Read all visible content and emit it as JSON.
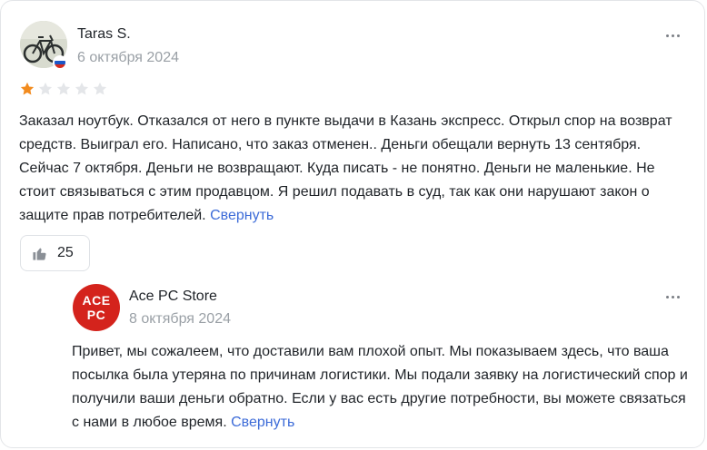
{
  "review": {
    "author": "Taras S.",
    "date": "6 октября 2024",
    "rating": 1,
    "rating_max": 5,
    "text": "Заказал ноутбук. Отказался от него в пункте выдачи в Казань экспресс. Открыл спор на возврат средств. Выиграл его. Написано, что заказ отменен.. Деньги обещали вернуть 13 сентября. Сейчас 7 октября. Деньги не возвращают. Куда писать - не понятно. Деньги не маленькие. Не стоит связываться с этим продавцом. Я решил подавать в суд, так как они нарушают закон о защите прав потребителей.",
    "collapse_label": "Свернуть",
    "likes": "25",
    "avatar_icon": "bicycle-photo",
    "flag_icon": "russia-flag-icon"
  },
  "reply": {
    "author": "Ace PC Store",
    "logo_line1": "ACE",
    "logo_line2": "PC",
    "date": "8 октября 2024",
    "text": "Привет, мы сожалеем, что доставили вам плохой опыт. Мы показываем здесь, что ваша посылка была утеряна по причинам логистики. Мы подали заявку на логистический спор и получили ваши деньги обратно. Если у вас есть другие потребности, вы можете связаться с нами в любое время.",
    "collapse_label": "Свернуть"
  },
  "colors": {
    "star_filled": "#f28b1e",
    "star_empty": "#e4e6e9",
    "link": "#3c6bd8",
    "muted": "#9aa0a6",
    "seller_brand": "#d4231c"
  }
}
